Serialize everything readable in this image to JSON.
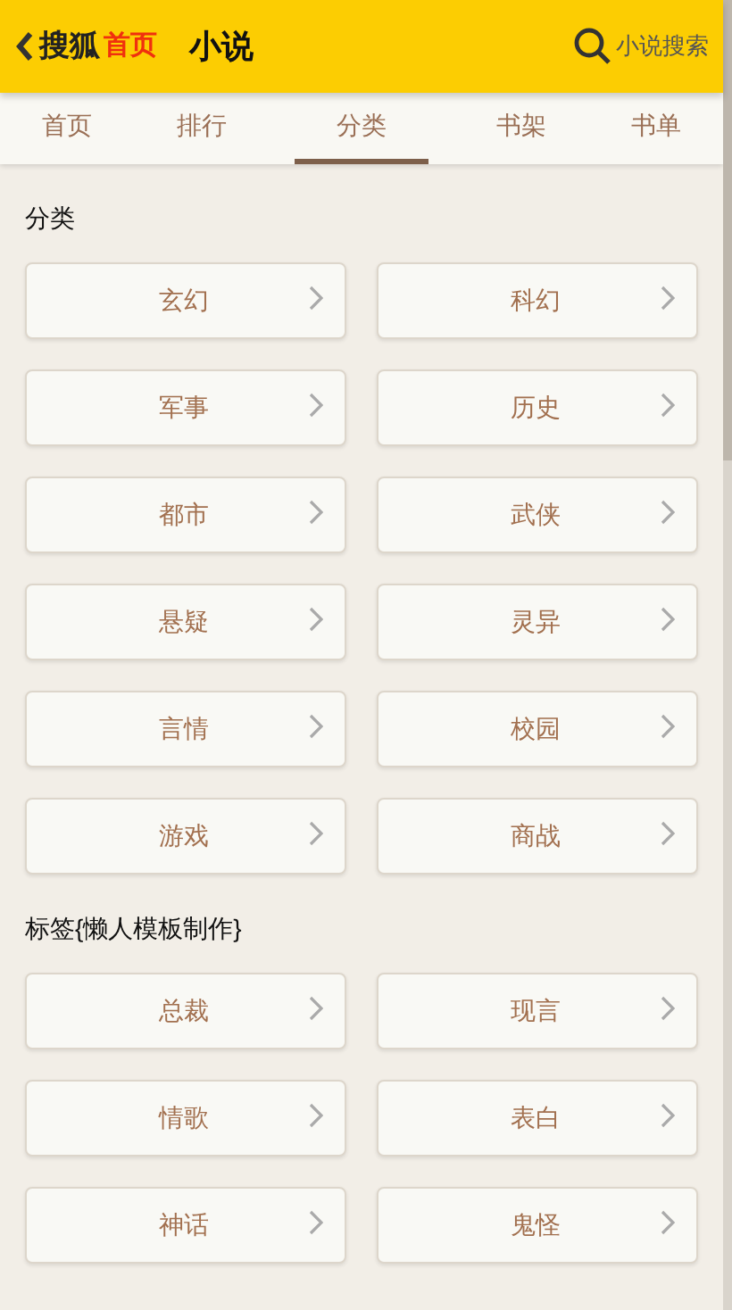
{
  "header": {
    "brand": "搜狐",
    "home": "首页",
    "title": "小说",
    "search": "小说搜索"
  },
  "tabs": [
    {
      "label": "首页",
      "selected": false
    },
    {
      "label": "排行",
      "selected": false
    },
    {
      "label": "分类",
      "selected": true
    },
    {
      "label": "书架",
      "selected": false
    },
    {
      "label": "书单",
      "selected": false
    }
  ],
  "sections": [
    {
      "title": "分类",
      "items": [
        "玄幻",
        "科幻",
        "军事",
        "历史",
        "都市",
        "武侠",
        "悬疑",
        "灵异",
        "言情",
        "校园",
        "游戏",
        "商战"
      ]
    },
    {
      "title": "标签{懒人模板制作}",
      "items": [
        "总裁",
        "现言",
        "情歌",
        "表白",
        "神话",
        "鬼怪"
      ]
    }
  ]
}
